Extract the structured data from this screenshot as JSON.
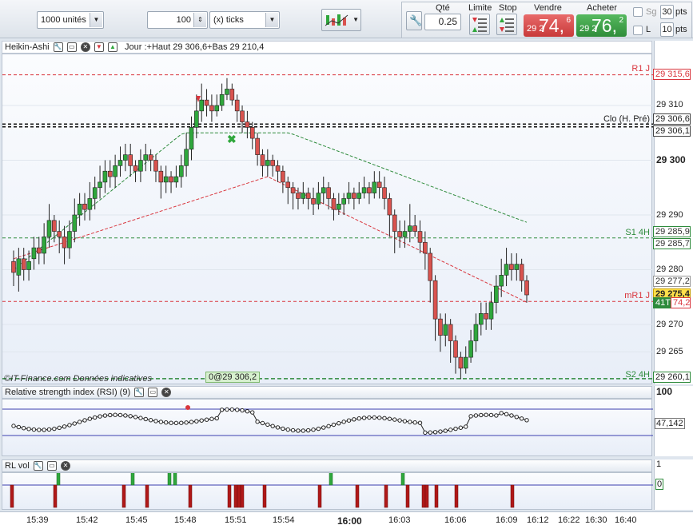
{
  "toolbar": {
    "units_value": "1000 unités",
    "ticks_value": "100",
    "ticks_unit": "(x) ticks",
    "qty_label": "Qté",
    "qty_value": "0.25",
    "limit_label": "Limite",
    "stop_label": "Stop",
    "sell_label": "Vendre",
    "buy_label": "Acheter",
    "sell_small": "29 2",
    "sell_big": "74,",
    "sell_sup": "6",
    "buy_small": "29 2",
    "buy_big": "76,",
    "buy_sup": "2",
    "sg_label": "Sg",
    "l_label": "L",
    "pts1_value": "30",
    "pts2_value": "10",
    "pts_unit": "pts"
  },
  "chart": {
    "title": "Heikin-Ashi",
    "info_text": "Jour :+Haut 29 306,6+Bas 29 210,4",
    "watermark": "©IT-Finance.com Données indicatives",
    "order_tag": "0@29 306,2",
    "lines": {
      "r1j": "R1 J",
      "clo": "Clo (H. Pré)",
      "s14h": "S1 4H",
      "mr1j": "mR1 J",
      "s24h": "S2 4H"
    },
    "price_axis": [
      "29 310",
      "29 300",
      "29 290",
      "29 280",
      "29 270",
      "29 265"
    ],
    "price_tags": {
      "r1j": "29 315,6",
      "clo1": "29 306,6",
      "clo2": "29 306,1",
      "s1a": "29 285,9",
      "s1b": "29 285,7",
      "t1": "29 277,2",
      "cur": "29 275,4",
      "spread": "41T",
      "t2": "74,2",
      "s2": "29 260,1"
    },
    "colors": {
      "bull": "#2fa73c",
      "bear": "#d9534f",
      "red_line": "#d9363e",
      "green_line": "#2e8b3c"
    }
  },
  "rsi": {
    "title": "Relative strength index (RSI) (9)",
    "axis_top": "100",
    "value": "47,142"
  },
  "rlvol": {
    "title": "RL vol",
    "axis_top": "1",
    "axis_zero": "0"
  },
  "xaxis": [
    "15:39",
    "15:42",
    "15:45",
    "15:48",
    "15:51",
    "15:54",
    "16:00",
    "16:03",
    "16:06",
    "16:09",
    "16:12",
    "16:22",
    "16:30",
    "16:40"
  ],
  "candles": [
    [
      29281.5,
      29279.5,
      29283.5,
      29277
    ],
    [
      29279,
      29282,
      29284,
      29276
    ],
    [
      29282,
      29280,
      29284,
      29278
    ],
    [
      29280,
      29281.5,
      29283.5,
      29278
    ],
    [
      29282,
      29284,
      29286,
      29280
    ],
    [
      29284,
      29283,
      29286,
      29281
    ],
    [
      29283,
      29286,
      29288.5,
      29281
    ],
    [
      29286,
      29289,
      29292,
      29284
    ],
    [
      29289,
      29287,
      29290,
      29285
    ],
    [
      29287,
      29286,
      29289,
      29283
    ],
    [
      29286,
      29284,
      29288,
      29281
    ],
    [
      29284,
      29287,
      29289,
      29282
    ],
    [
      29287,
      29290,
      29293,
      29285
    ],
    [
      29290,
      29292,
      29294,
      29288
    ],
    [
      29292,
      29291,
      29294,
      29289
    ],
    [
      29291,
      29293,
      29296,
      29289
    ],
    [
      29293,
      29295,
      29297,
      29291
    ],
    [
      29295,
      29296,
      29299,
      29293
    ],
    [
      29296,
      29298,
      29300,
      29294
    ],
    [
      29298,
      29297,
      29300,
      29295
    ],
    [
      29297,
      29299,
      29301,
      29295
    ],
    [
      29299,
      29300,
      29302.5,
      29297
    ],
    [
      29300,
      29301,
      29303,
      29298
    ],
    [
      29301,
      29299,
      29303,
      29297
    ],
    [
      29299,
      29298,
      29300,
      29296
    ],
    [
      29298,
      29300,
      29302,
      29296
    ],
    [
      29300,
      29301,
      29303,
      29298
    ],
    [
      29301,
      29300,
      29302,
      29298
    ],
    [
      29300,
      29298,
      29301,
      29296
    ],
    [
      29298,
      29296,
      29299,
      29293
    ],
    [
      29296,
      29297,
      29299,
      29294
    ],
    [
      29297,
      29296,
      29298,
      29294
    ],
    [
      29296,
      29297,
      29299,
      29295
    ],
    [
      29297,
      29299,
      29301,
      29295
    ],
    [
      29299,
      29302,
      29305,
      29297
    ],
    [
      29302,
      29306,
      29308,
      29300
    ],
    [
      29306,
      29309,
      29312,
      29304
    ],
    [
      29309,
      29311,
      29314,
      29307
    ],
    [
      29311,
      29310,
      29313,
      29308
    ],
    [
      29310,
      29309,
      29312,
      29307
    ],
    [
      29309,
      29310,
      29312,
      29308
    ],
    [
      29310,
      29312,
      29314,
      29309
    ],
    [
      29312,
      29313,
      29315,
      29311
    ],
    [
      29313,
      29311,
      29314,
      29310
    ],
    [
      29311,
      29309,
      29312,
      29307
    ],
    [
      29309,
      29307,
      29310,
      29305
    ],
    [
      29307,
      29306,
      29309,
      29304
    ],
    [
      29306,
      29304,
      29307,
      29302
    ],
    [
      29304,
      29301,
      29305,
      29299
    ],
    [
      29301,
      29299,
      29302,
      29297
    ],
    [
      29299,
      29300,
      29302,
      29297
    ],
    [
      29300,
      29299,
      29301,
      29297
    ],
    [
      29299,
      29298,
      29300,
      29296
    ],
    [
      29298,
      29296,
      29299,
      29294
    ],
    [
      29296,
      29295,
      29297,
      29292
    ],
    [
      29295,
      29294,
      29296,
      29291
    ],
    [
      29294,
      29293,
      29295,
      29291
    ],
    [
      29293,
      29294,
      29296,
      29292
    ],
    [
      29294,
      29293,
      29295,
      29291
    ],
    [
      29293,
      29292,
      29295,
      29290
    ],
    [
      29292,
      29294,
      29296,
      29291
    ],
    [
      29294,
      29295,
      29297,
      29292
    ],
    [
      29295,
      29293,
      29296,
      29291
    ],
    [
      29293,
      29291,
      29294,
      29289
    ],
    [
      29291,
      29292,
      29294,
      29290
    ],
    [
      29292,
      29293,
      29294,
      29290
    ],
    [
      29293,
      29294,
      29296,
      29292
    ],
    [
      29294,
      29293,
      29295,
      29291
    ],
    [
      29293,
      29294,
      29296,
      29292
    ],
    [
      29294,
      29295,
      29297,
      29293
    ],
    [
      29295,
      29294,
      29296,
      29292
    ],
    [
      29294,
      29296,
      29298,
      29293
    ],
    [
      29296,
      29295,
      29298,
      29293
    ],
    [
      29295,
      29293,
      29297,
      29291
    ],
    [
      29293,
      29290,
      29294,
      29286
    ],
    [
      29290,
      29287,
      29291,
      29283
    ],
    [
      29287,
      29286,
      29289,
      29284
    ],
    [
      29286,
      29287,
      29289,
      29284
    ],
    [
      29287,
      29288,
      29292,
      29285
    ],
    [
      29288,
      29287,
      29290,
      29286
    ],
    [
      29287,
      29285,
      29289,
      29283
    ],
    [
      29285,
      29283,
      29287,
      29280
    ],
    [
      29283,
      29278,
      29284,
      29274
    ],
    [
      29278,
      29271,
      29279,
      29267
    ],
    [
      29271,
      29268,
      29272,
      29265
    ],
    [
      29268,
      29270,
      29272,
      29266
    ],
    [
      29270,
      29267,
      29271,
      29263
    ],
    [
      29267,
      29264,
      29268,
      29261
    ],
    [
      29264,
      29262,
      29265,
      29260
    ],
    [
      29262,
      29264,
      29266,
      29261
    ],
    [
      29264,
      29267,
      29269,
      29263
    ],
    [
      29267,
      29270,
      29272,
      29265
    ],
    [
      29270,
      29272,
      29274,
      29268
    ],
    [
      29272,
      29271,
      29274,
      29269
    ],
    [
      29271,
      29274,
      29276,
      29269
    ],
    [
      29274,
      29277,
      29279,
      29272
    ],
    [
      29277,
      29279,
      29282,
      29275
    ],
    [
      29279,
      29281,
      29284,
      29277
    ],
    [
      29281,
      29280,
      29283,
      29278
    ],
    [
      29280,
      29281,
      29283,
      29278
    ],
    [
      29281,
      29278,
      29282,
      29276
    ],
    [
      29278,
      29275.4,
      29279,
      29274
    ]
  ]
}
